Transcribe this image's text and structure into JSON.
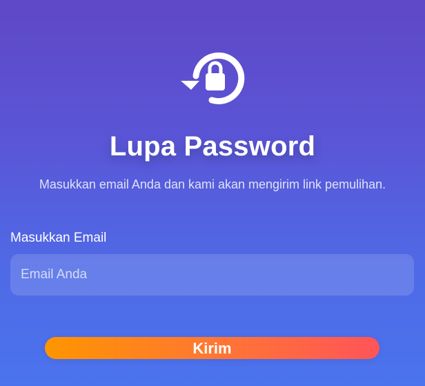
{
  "header": {
    "icon": "reset-password-lock-icon",
    "title": "Lupa Password",
    "subtitle": "Masukkan email Anda dan kami akan mengirim link pemulihan."
  },
  "form": {
    "email_label": "Masukkan Email",
    "email_value": "",
    "email_placeholder": "Email Anda",
    "submit_label": "Kirim"
  },
  "colors": {
    "background_top": "#5f48c7",
    "background_bottom": "#4b73ee",
    "button_start": "#ff9500",
    "button_end": "#ff5458",
    "text": "#ffffff"
  }
}
